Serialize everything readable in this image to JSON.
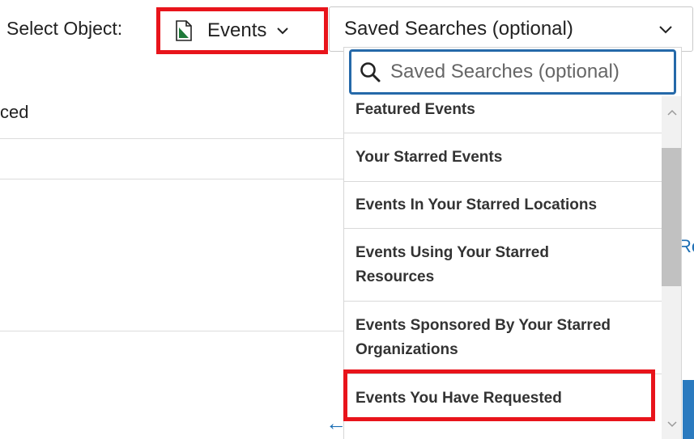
{
  "header": {
    "select_label": "Select Object:",
    "object_value": "Events",
    "saved_searches_placeholder": "Saved Searches (optional)"
  },
  "background": {
    "partial_text": "ced",
    "partial_right_text": "Re",
    "arrow_glyph": "←"
  },
  "dropdown": {
    "search_placeholder": "Saved Searches (optional)",
    "items": [
      {
        "label": "Featured Events"
      },
      {
        "label": "Your Starred Events"
      },
      {
        "label": "Events In Your Starred Locations"
      },
      {
        "label": "Events Using Your Starred Resources"
      },
      {
        "label": "Events Sponsored By Your Starred Organizations"
      },
      {
        "label": "Events You Have Requested"
      }
    ]
  },
  "icons": {
    "object_icon": "document-icon",
    "search_icon": "search-icon",
    "chevron": "chevron-down-icon"
  },
  "colors": {
    "highlight": "#e8141b",
    "focus_border": "#2569a9",
    "doc_icon_green": "#1f7a3a",
    "link_blue": "#1d6fb5"
  }
}
